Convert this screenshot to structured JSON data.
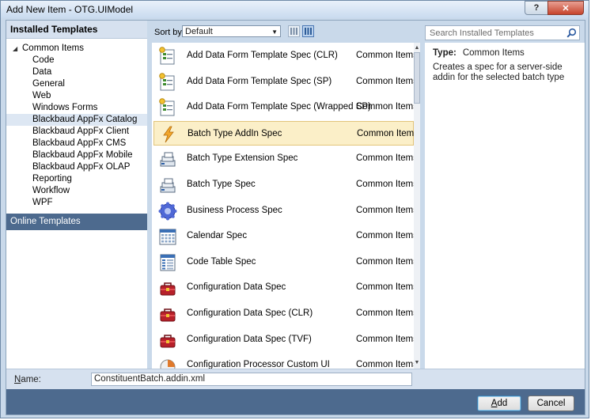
{
  "window": {
    "title": "Add New Item - OTG.UIModel",
    "help_label": "?",
    "close_label": "✕"
  },
  "left_pane": {
    "installed_header": "Installed Templates",
    "tree": [
      {
        "label": "Common Items",
        "root": true,
        "expanded": true
      },
      {
        "label": "Code"
      },
      {
        "label": "Data"
      },
      {
        "label": "General"
      },
      {
        "label": "Web"
      },
      {
        "label": "Windows Forms"
      },
      {
        "label": "Blackbaud AppFx Catalog",
        "selected": true
      },
      {
        "label": "Blackbaud AppFx Client"
      },
      {
        "label": "Blackbaud AppFx CMS"
      },
      {
        "label": "Blackbaud AppFx Mobile"
      },
      {
        "label": "Blackbaud AppFx OLAP"
      },
      {
        "label": "Reporting"
      },
      {
        "label": "Workflow"
      },
      {
        "label": "WPF"
      }
    ],
    "online_templates": "Online Templates"
  },
  "toolbar": {
    "sort_label": "Sort by:",
    "sort_value": "Default"
  },
  "items": [
    {
      "name": "Add Data Form Template Spec (CLR)",
      "category": "Common Items",
      "icon": "form-spec-icon"
    },
    {
      "name": "Add Data Form Template Spec (SP)",
      "category": "Common Items",
      "icon": "form-spec-icon"
    },
    {
      "name": "Add Data Form Template Spec (Wrapped SP)",
      "category": "Common Items",
      "icon": "form-spec-icon"
    },
    {
      "name": "Batch Type AddIn Spec",
      "category": "Common Items",
      "icon": "lightning-icon",
      "selected": true
    },
    {
      "name": "Batch Type Extension Spec",
      "category": "Common Items",
      "icon": "batch-stack-icon"
    },
    {
      "name": "Batch Type Spec",
      "category": "Common Items",
      "icon": "batch-stack-icon"
    },
    {
      "name": "Business Process Spec",
      "category": "Common Items",
      "icon": "gear-icon"
    },
    {
      "name": "Calendar Spec",
      "category": "Common Items",
      "icon": "calendar-icon"
    },
    {
      "name": "Code Table Spec",
      "category": "Common Items",
      "icon": "code-table-icon"
    },
    {
      "name": "Configuration Data Spec",
      "category": "Common Items",
      "icon": "toolbox-icon"
    },
    {
      "name": "Configuration Data Spec (CLR)",
      "category": "Common Items",
      "icon": "toolbox-icon"
    },
    {
      "name": "Configuration Data Spec (TVF)",
      "category": "Common Items",
      "icon": "toolbox-icon"
    },
    {
      "name": "Configuration Processor Custom UI",
      "category": "Common Items",
      "icon": "processor-icon"
    }
  ],
  "search": {
    "placeholder": "Search Installed Templates"
  },
  "details": {
    "type_label": "Type:",
    "type_value": "Common Items",
    "description": "Creates a spec for a server-side addin for the selected batch type"
  },
  "name_field": {
    "label": "Name:",
    "value": "ConstituentBatch.addin.xml"
  },
  "buttons": {
    "add": "Add",
    "cancel": "Cancel"
  }
}
